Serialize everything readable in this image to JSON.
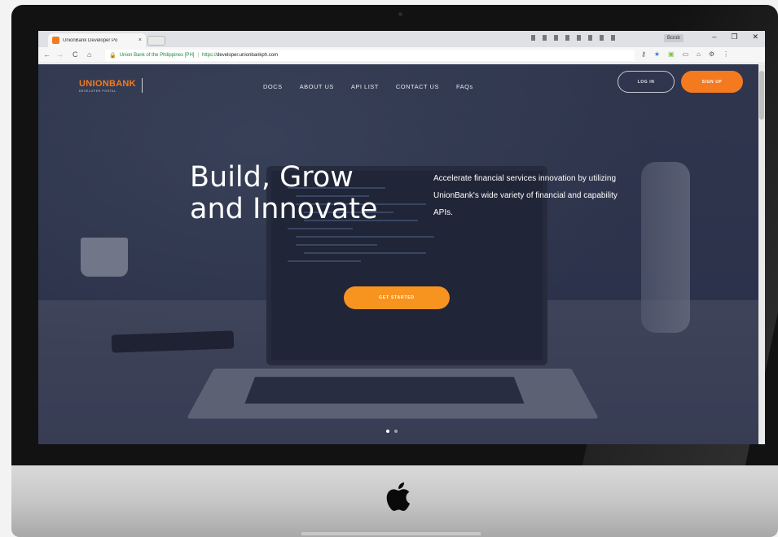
{
  "browser": {
    "tab_title": "UnionBank Developer Po",
    "tab_close": "×",
    "user_chip": "Bcrob",
    "window_controls": [
      "–",
      "❐",
      "✕"
    ],
    "nav": {
      "back": "←",
      "forward": "→",
      "reload": "C",
      "home": "⌂"
    },
    "omnibox": {
      "lock": "🔒",
      "secure_label": "Union Bank of the Philippines [PH]",
      "separator": "|",
      "scheme": "https://",
      "host": "developer.unionbankph.com"
    },
    "toolbar_icons": [
      {
        "name": "key-icon",
        "glyph": "⚷"
      },
      {
        "name": "bookmark-star-icon",
        "glyph": "★"
      },
      {
        "name": "android-icon",
        "glyph": "▣"
      },
      {
        "name": "cast-icon",
        "glyph": "▭"
      },
      {
        "name": "extension-icon",
        "glyph": "⌂"
      },
      {
        "name": "settings-icon",
        "glyph": "⚙"
      },
      {
        "name": "menu-icon",
        "glyph": "⋮"
      }
    ]
  },
  "site": {
    "logo": {
      "main": "UNIONBANK",
      "sub": "DEVELOPER PORTAL"
    },
    "nav": [
      "DOCS",
      "ABOUT US",
      "API LIST",
      "CONTACT US",
      "FAQs"
    ],
    "login_label": "LOG IN",
    "signup_label": "SIGN UP",
    "headline_line1": "Build, Grow",
    "headline_line2": "and Innovate",
    "tagline": "Accelerate financial services innovation by utilizing UnionBank's wide variety of financial and capability APIs.",
    "cta_label": "GET STARTED",
    "carousel": {
      "slides": 2,
      "active": 1
    }
  },
  "colors": {
    "accent": "#f47a20",
    "cta": "#f79420"
  }
}
